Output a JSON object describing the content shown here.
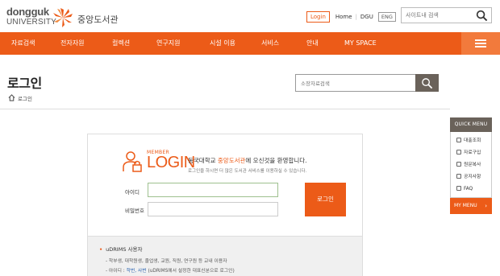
{
  "header": {
    "logo_en_line1": "dongguk",
    "logo_en_line2": "UNIVERSITY",
    "logo_ko": "중앙도서관",
    "login_label": "Login",
    "home_label": "Home",
    "dgu_label": "DGU",
    "eng_label": "ENG",
    "search_placeholder": "사이트내 검색"
  },
  "nav": {
    "items": [
      "자료검색",
      "전자자원",
      "컬렉션",
      "연구지원",
      "시설 이용",
      "서비스",
      "안내",
      "MY SPACE"
    ]
  },
  "page": {
    "title": "로그인",
    "breadcrumb": "로그인",
    "search_placeholder": "소장자료검색"
  },
  "quick_menu": {
    "title": "QUICK MENU",
    "items": [
      "대출조회",
      "자료구입",
      "원문복사",
      "공지사항",
      "FAQ"
    ],
    "my_menu": "MY MENU"
  },
  "login": {
    "member_label": "MEMBER",
    "login_label": "LOGIN",
    "welcome_pre": "동국대학교 ",
    "welcome_hl": "중앙도서관",
    "welcome_post": "에 오신것을 환영합니다.",
    "guide": "로그인을 하시면 더 많은 도서관 서비스를 이용하실 수 있습니다.",
    "id_label": "아이디",
    "pw_label": "비밀번호",
    "submit_label": "로그인"
  },
  "info": {
    "heading": "uDRIMS 사용자",
    "line1": "- 학부생, 대학원생, 졸업생, 교원, 직원, 연구원 등 교내 이용자",
    "line2_pre": "- 아이디 : ",
    "line2_hl": "학번, 사번",
    "line2_post": " (uDRIMS에서 설정한 대표신분으로 로그인)"
  },
  "colors": {
    "brand_orange": "#ec5b18",
    "dark_button": "#6a625a"
  }
}
